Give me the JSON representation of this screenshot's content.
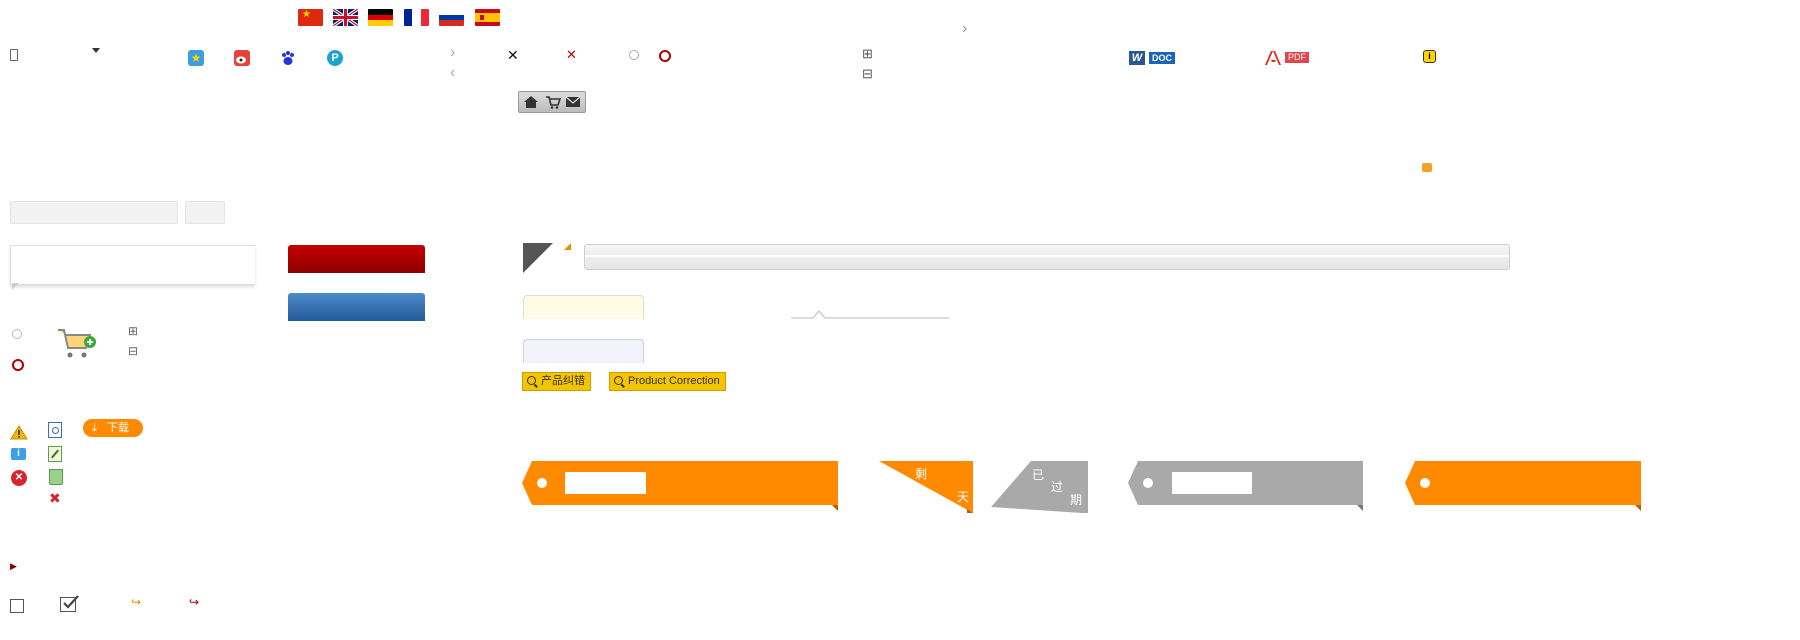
{
  "flags": [
    "china-flag-icon",
    "uk-flag-icon",
    "germany-flag-icon",
    "france-flag-icon",
    "russia-flag-icon",
    "spain-flag-icon"
  ],
  "symbols": {
    "close": "✕",
    "chevron_right": "›",
    "chevron_left": "‹",
    "play": "▶",
    "redo": "↪",
    "expand": "⊞",
    "collapse": "⊟",
    "close_bold": "✖"
  },
  "doc_label": "DOC",
  "pdf_label": "PDF",
  "download": {
    "label": "下载"
  },
  "correction_buttons": {
    "zh": "产品纠错",
    "en": "Product Correction"
  },
  "countdown": {
    "remaining_prefix": "剩",
    "remaining_suffix": "天"
  },
  "expired": {
    "char1": "已",
    "char2": "过",
    "char3": "期"
  },
  "colors": {
    "orange": "#ff8a00",
    "gray": "#a9a9a9",
    "dark_red": "#8b0000",
    "red_button": "#a00000",
    "blue_button": "#2f6aa8",
    "warning": "#f5b800",
    "info": "#3aa0e8"
  }
}
